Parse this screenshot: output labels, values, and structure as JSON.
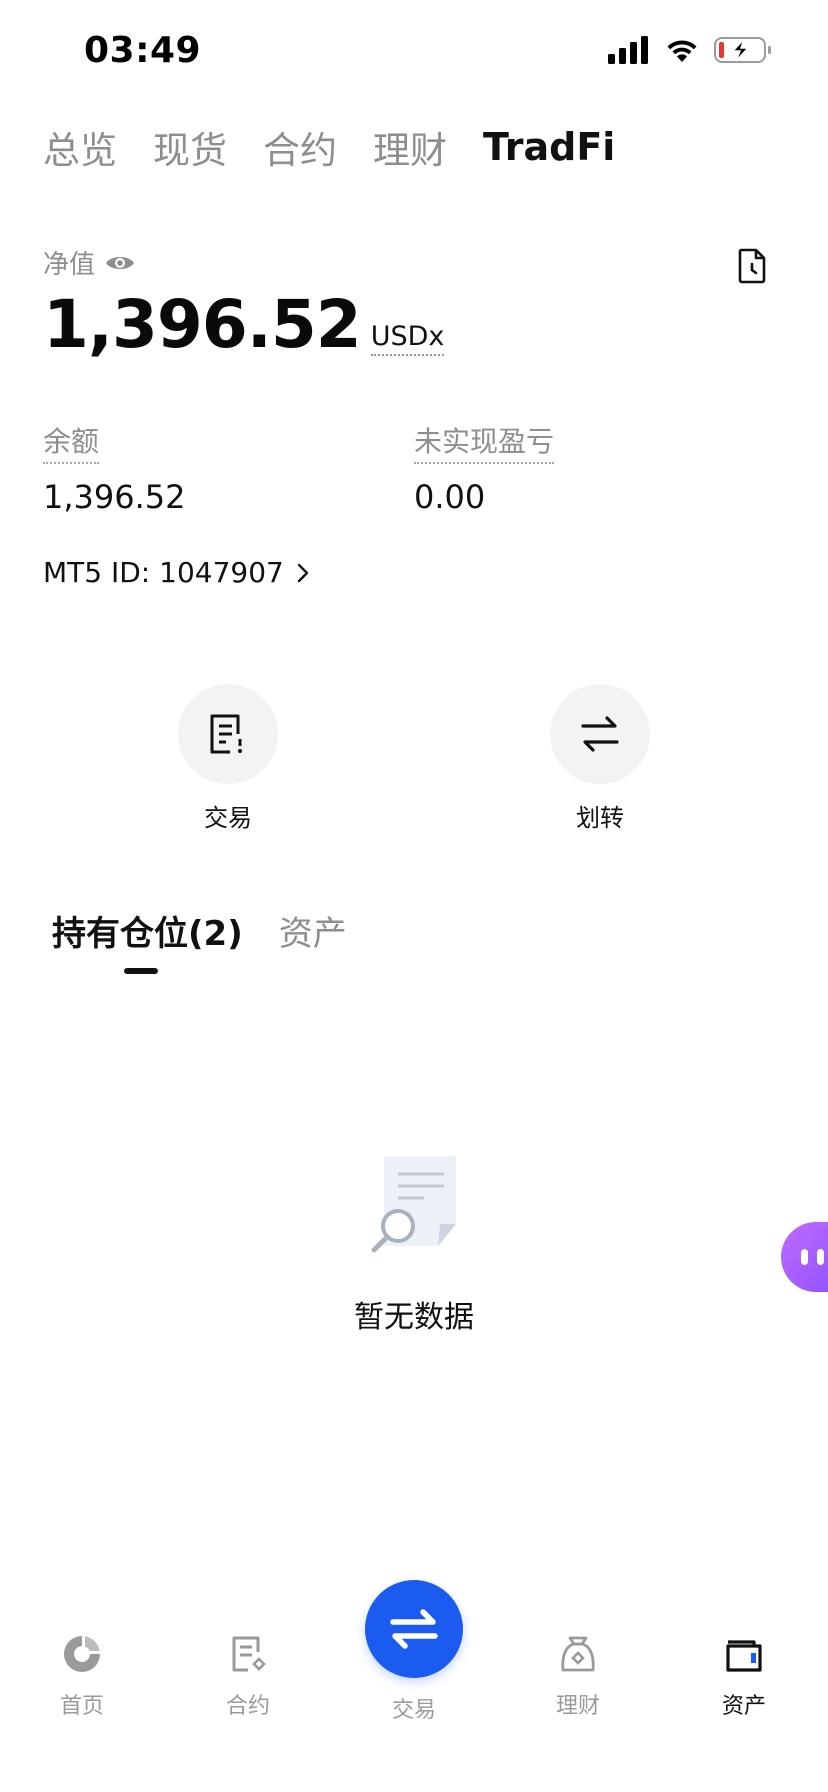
{
  "status_bar": {
    "time": "03:49",
    "icons": [
      "signal-icon",
      "wifi-icon",
      "battery-charging-icon"
    ]
  },
  "top_tabs": [
    {
      "label": "总览",
      "active": false
    },
    {
      "label": "现货",
      "active": false
    },
    {
      "label": "合约",
      "active": false
    },
    {
      "label": "理财",
      "active": false
    },
    {
      "label": "TradFi",
      "active": true
    }
  ],
  "account": {
    "net_value_label": "净值",
    "net_value": "1,396.52",
    "unit": "USDx",
    "balance_label": "余额",
    "balance_value": "1,396.52",
    "unrealized_label": "未实现盈亏",
    "unrealized_value": "0.00",
    "mt5_id": "MT5 ID: 1047907"
  },
  "actions": [
    {
      "label": "交易",
      "icon": "order-list-icon"
    },
    {
      "label": "划转",
      "icon": "transfer-arrows-icon"
    }
  ],
  "section_tabs": [
    {
      "label": "持有仓位(2)",
      "active": true
    },
    {
      "label": "资产",
      "active": false
    }
  ],
  "empty_state": {
    "text": "暂无数据",
    "icon": "document-search-icon"
  },
  "bottom_nav": [
    {
      "label": "首页",
      "icon": "home-logo-icon",
      "active": false
    },
    {
      "label": "合约",
      "icon": "contract-icon",
      "active": false
    },
    {
      "label": "交易",
      "icon": "trade-swap-icon",
      "active": false
    },
    {
      "label": "理财",
      "icon": "finance-bag-icon",
      "active": false
    },
    {
      "label": "资产",
      "icon": "wallet-icon",
      "active": true
    }
  ],
  "colors": {
    "accent": "#1b5bf0",
    "text_primary": "#111111",
    "text_secondary": "#8e8e8e",
    "bot_gradient_start": "#c06cff",
    "bot_gradient_end": "#8a4dff",
    "battery_low": "#e53935"
  }
}
